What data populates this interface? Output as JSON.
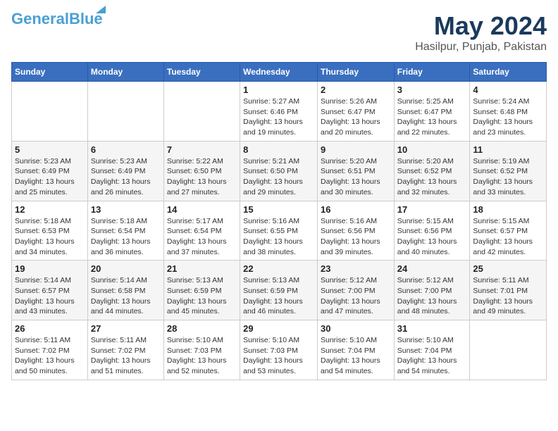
{
  "logo": {
    "line1": "General",
    "line2": "Blue"
  },
  "title": "May 2024",
  "subtitle": "Hasilpur, Punjab, Pakistan",
  "weekdays": [
    "Sunday",
    "Monday",
    "Tuesday",
    "Wednesday",
    "Thursday",
    "Friday",
    "Saturday"
  ],
  "weeks": [
    [
      {
        "day": "",
        "info": ""
      },
      {
        "day": "",
        "info": ""
      },
      {
        "day": "",
        "info": ""
      },
      {
        "day": "1",
        "info": "Sunrise: 5:27 AM\nSunset: 6:46 PM\nDaylight: 13 hours\nand 19 minutes."
      },
      {
        "day": "2",
        "info": "Sunrise: 5:26 AM\nSunset: 6:47 PM\nDaylight: 13 hours\nand 20 minutes."
      },
      {
        "day": "3",
        "info": "Sunrise: 5:25 AM\nSunset: 6:47 PM\nDaylight: 13 hours\nand 22 minutes."
      },
      {
        "day": "4",
        "info": "Sunrise: 5:24 AM\nSunset: 6:48 PM\nDaylight: 13 hours\nand 23 minutes."
      }
    ],
    [
      {
        "day": "5",
        "info": "Sunrise: 5:23 AM\nSunset: 6:49 PM\nDaylight: 13 hours\nand 25 minutes."
      },
      {
        "day": "6",
        "info": "Sunrise: 5:23 AM\nSunset: 6:49 PM\nDaylight: 13 hours\nand 26 minutes."
      },
      {
        "day": "7",
        "info": "Sunrise: 5:22 AM\nSunset: 6:50 PM\nDaylight: 13 hours\nand 27 minutes."
      },
      {
        "day": "8",
        "info": "Sunrise: 5:21 AM\nSunset: 6:50 PM\nDaylight: 13 hours\nand 29 minutes."
      },
      {
        "day": "9",
        "info": "Sunrise: 5:20 AM\nSunset: 6:51 PM\nDaylight: 13 hours\nand 30 minutes."
      },
      {
        "day": "10",
        "info": "Sunrise: 5:20 AM\nSunset: 6:52 PM\nDaylight: 13 hours\nand 32 minutes."
      },
      {
        "day": "11",
        "info": "Sunrise: 5:19 AM\nSunset: 6:52 PM\nDaylight: 13 hours\nand 33 minutes."
      }
    ],
    [
      {
        "day": "12",
        "info": "Sunrise: 5:18 AM\nSunset: 6:53 PM\nDaylight: 13 hours\nand 34 minutes."
      },
      {
        "day": "13",
        "info": "Sunrise: 5:18 AM\nSunset: 6:54 PM\nDaylight: 13 hours\nand 36 minutes."
      },
      {
        "day": "14",
        "info": "Sunrise: 5:17 AM\nSunset: 6:54 PM\nDaylight: 13 hours\nand 37 minutes."
      },
      {
        "day": "15",
        "info": "Sunrise: 5:16 AM\nSunset: 6:55 PM\nDaylight: 13 hours\nand 38 minutes."
      },
      {
        "day": "16",
        "info": "Sunrise: 5:16 AM\nSunset: 6:56 PM\nDaylight: 13 hours\nand 39 minutes."
      },
      {
        "day": "17",
        "info": "Sunrise: 5:15 AM\nSunset: 6:56 PM\nDaylight: 13 hours\nand 40 minutes."
      },
      {
        "day": "18",
        "info": "Sunrise: 5:15 AM\nSunset: 6:57 PM\nDaylight: 13 hours\nand 42 minutes."
      }
    ],
    [
      {
        "day": "19",
        "info": "Sunrise: 5:14 AM\nSunset: 6:57 PM\nDaylight: 13 hours\nand 43 minutes."
      },
      {
        "day": "20",
        "info": "Sunrise: 5:14 AM\nSunset: 6:58 PM\nDaylight: 13 hours\nand 44 minutes."
      },
      {
        "day": "21",
        "info": "Sunrise: 5:13 AM\nSunset: 6:59 PM\nDaylight: 13 hours\nand 45 minutes."
      },
      {
        "day": "22",
        "info": "Sunrise: 5:13 AM\nSunset: 6:59 PM\nDaylight: 13 hours\nand 46 minutes."
      },
      {
        "day": "23",
        "info": "Sunrise: 5:12 AM\nSunset: 7:00 PM\nDaylight: 13 hours\nand 47 minutes."
      },
      {
        "day": "24",
        "info": "Sunrise: 5:12 AM\nSunset: 7:00 PM\nDaylight: 13 hours\nand 48 minutes."
      },
      {
        "day": "25",
        "info": "Sunrise: 5:11 AM\nSunset: 7:01 PM\nDaylight: 13 hours\nand 49 minutes."
      }
    ],
    [
      {
        "day": "26",
        "info": "Sunrise: 5:11 AM\nSunset: 7:02 PM\nDaylight: 13 hours\nand 50 minutes."
      },
      {
        "day": "27",
        "info": "Sunrise: 5:11 AM\nSunset: 7:02 PM\nDaylight: 13 hours\nand 51 minutes."
      },
      {
        "day": "28",
        "info": "Sunrise: 5:10 AM\nSunset: 7:03 PM\nDaylight: 13 hours\nand 52 minutes."
      },
      {
        "day": "29",
        "info": "Sunrise: 5:10 AM\nSunset: 7:03 PM\nDaylight: 13 hours\nand 53 minutes."
      },
      {
        "day": "30",
        "info": "Sunrise: 5:10 AM\nSunset: 7:04 PM\nDaylight: 13 hours\nand 54 minutes."
      },
      {
        "day": "31",
        "info": "Sunrise: 5:10 AM\nSunset: 7:04 PM\nDaylight: 13 hours\nand 54 minutes."
      },
      {
        "day": "",
        "info": ""
      }
    ]
  ]
}
